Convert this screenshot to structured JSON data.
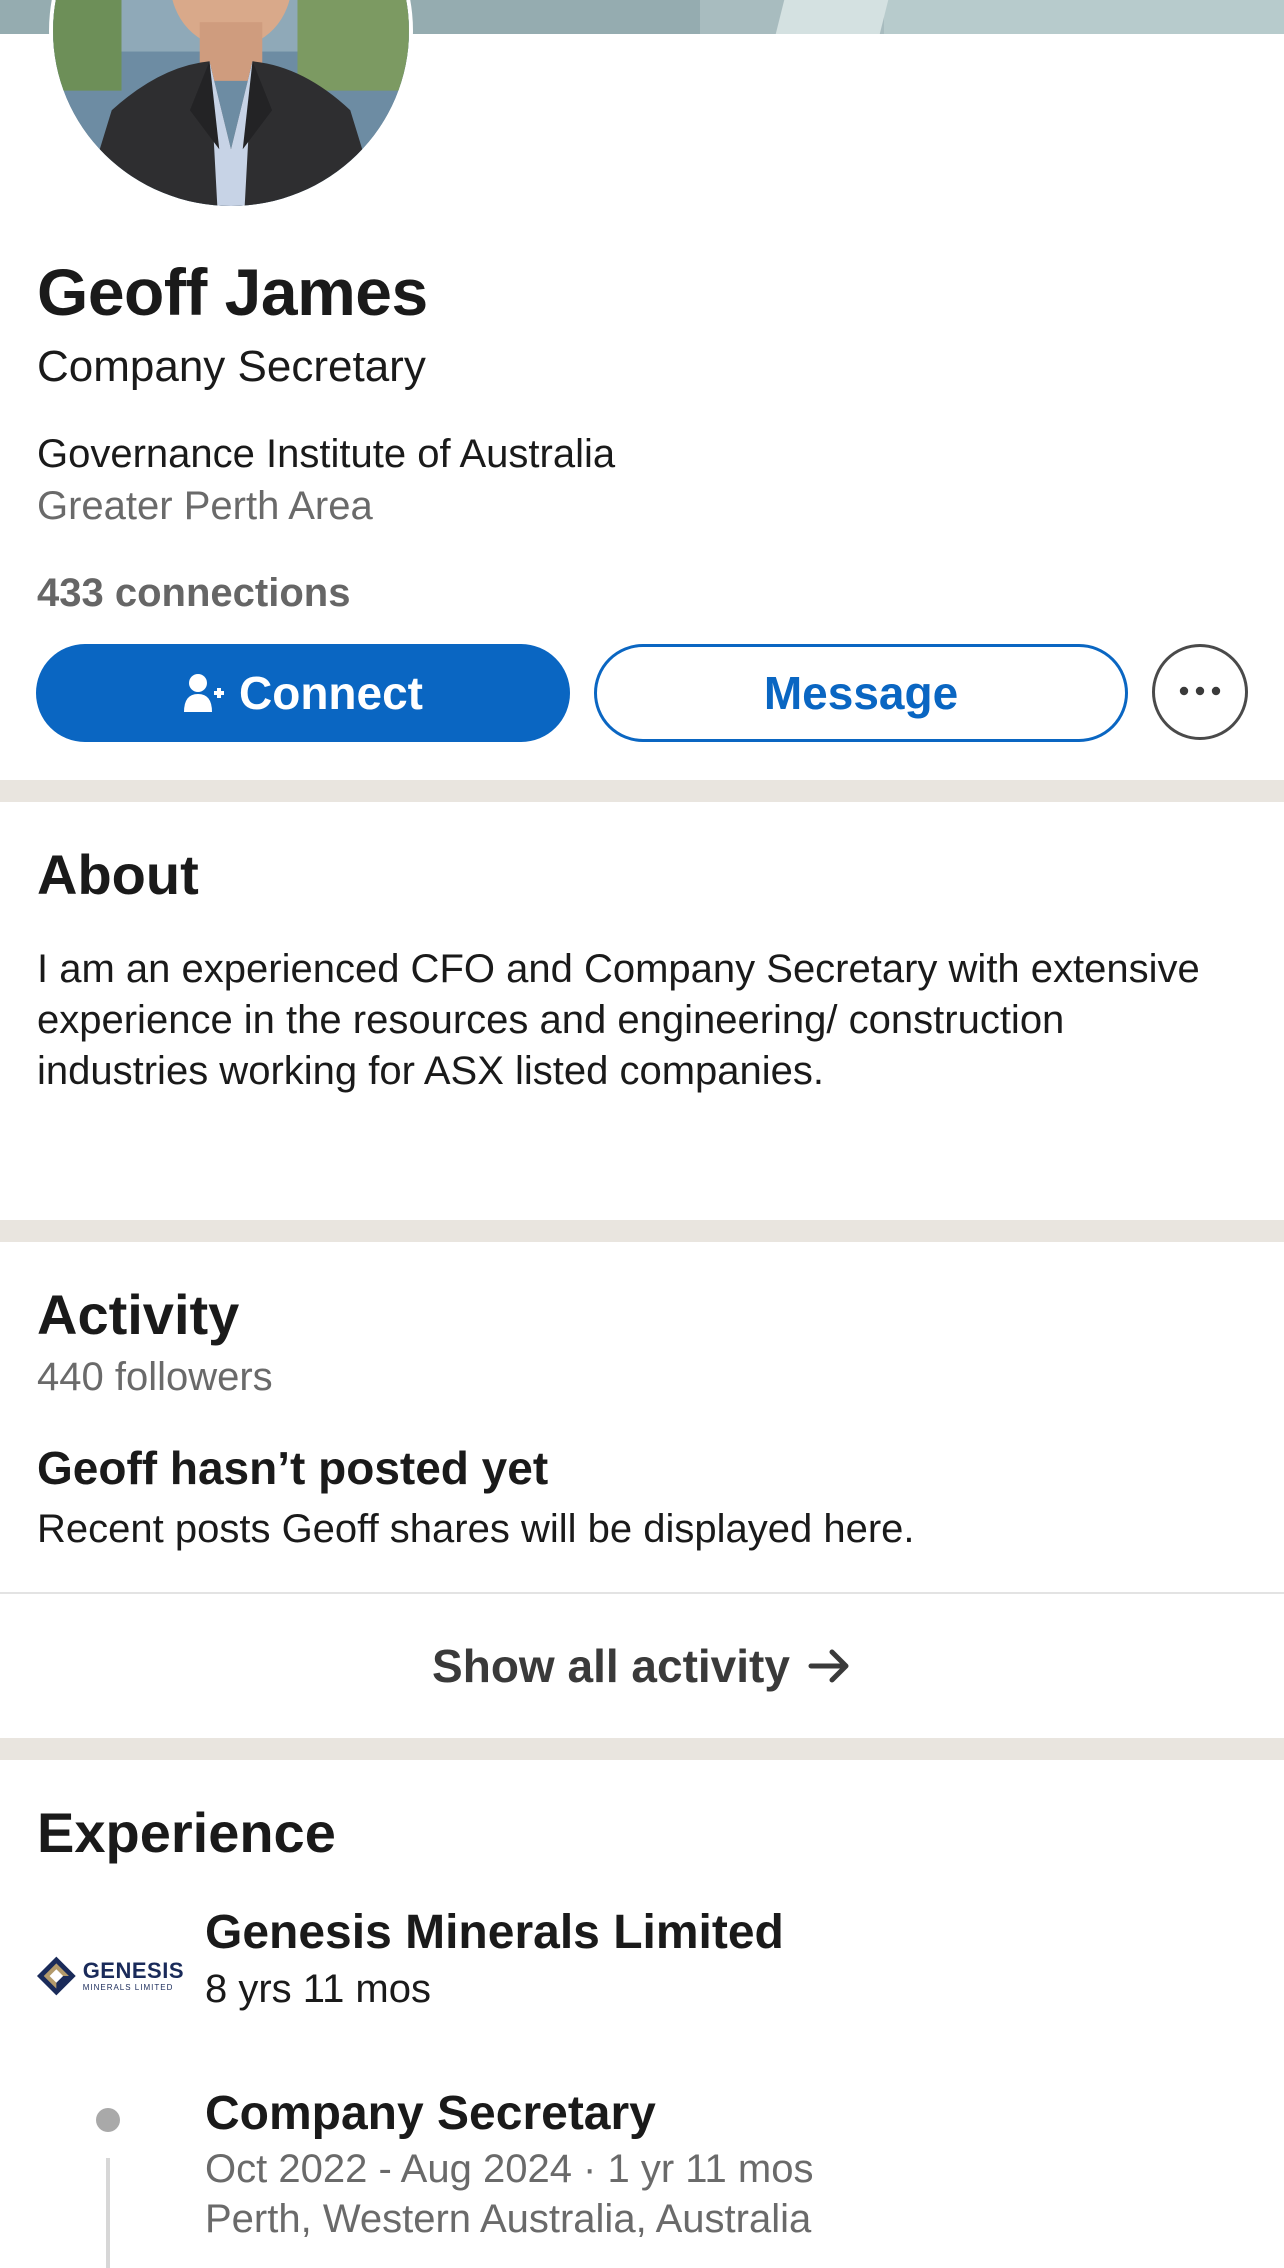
{
  "profile": {
    "name": "Geoff James",
    "headline": "Company Secretary",
    "company": "Governance Institute of Australia",
    "location": "Greater Perth Area",
    "connections": "433 connections"
  },
  "actions": {
    "connect_label": "Connect",
    "message_label": "Message",
    "connect_icon": "person-add-icon",
    "more_icon": "more-horizontal-icon"
  },
  "about": {
    "title": "About",
    "text": "I am an experienced CFO and Company Secretary with extensive experience in the resources and engineering/ construction industries working for ASX listed companies."
  },
  "activity": {
    "title": "Activity",
    "followers": "440 followers",
    "empty_title": "Geoff hasn’t posted yet",
    "empty_subtitle": "Recent posts Geoff shares will be displayed here.",
    "show_all_label": "Show all activity",
    "show_all_icon": "arrow-right-icon"
  },
  "experience": {
    "title": "Experience",
    "company": {
      "name": "Genesis Minerals Limited",
      "duration": "8 yrs 11 mos",
      "logo_text": "GENESIS",
      "logo_subtext": "MINERALS LIMITED"
    },
    "roles": [
      {
        "title": "Company Secretary",
        "dates": "Oct 2022 - Aug 2024 · 1 yr 11 mos",
        "location": "Perth, Western Australia, Australia"
      }
    ]
  },
  "colors": {
    "primary": "#0a66c2",
    "section_divider": "#e9e5df",
    "muted_text": "#6a6a6a"
  }
}
